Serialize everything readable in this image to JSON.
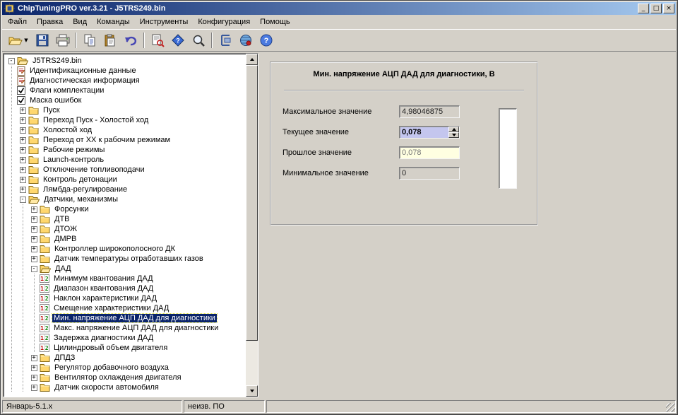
{
  "window": {
    "title": "ChipTuningPRO ver.3.21 - J5TRS249.bin",
    "controls": {
      "minimize": "_",
      "maximize": "□",
      "close": "×"
    }
  },
  "colors": {
    "titlebar_start": "#0a246a",
    "titlebar_end": "#a6caf0",
    "selection": "#0a246a",
    "chrome": "#d4d0c8",
    "editable_field": "#c4c6ee",
    "previous_field": "#ffffe1"
  },
  "menu": {
    "items": [
      {
        "id": "file",
        "label": "Файл"
      },
      {
        "id": "edit",
        "label": "Правка"
      },
      {
        "id": "view",
        "label": "Вид"
      },
      {
        "id": "commands",
        "label": "Команды"
      },
      {
        "id": "tools",
        "label": "Инструменты"
      },
      {
        "id": "configuration",
        "label": "Конфигурация"
      },
      {
        "id": "help",
        "label": "Помощь"
      }
    ]
  },
  "toolbar": {
    "buttons": [
      {
        "id": "open",
        "icon": "open",
        "dropdown": true
      },
      {
        "id": "save",
        "icon": "save"
      },
      {
        "id": "print",
        "icon": "print"
      },
      {
        "sep": true
      },
      {
        "id": "copy",
        "icon": "copy"
      },
      {
        "id": "paste",
        "icon": "paste"
      },
      {
        "id": "undo",
        "icon": "undo"
      },
      {
        "sep": true
      },
      {
        "id": "view-data",
        "icon": "doc-search"
      },
      {
        "id": "compare",
        "icon": "compare"
      },
      {
        "id": "search",
        "icon": "search"
      },
      {
        "sep": true
      },
      {
        "id": "calibration",
        "icon": "calibration"
      },
      {
        "id": "online",
        "icon": "globe"
      },
      {
        "id": "help",
        "icon": "help"
      }
    ]
  },
  "tree": {
    "root": {
      "label": "J5TRS249.bin",
      "icon": "folder-open",
      "expanded": true,
      "children": [
        {
          "label": "Идентификационные данные",
          "icon": "doc"
        },
        {
          "label": "Диагностическая информация",
          "icon": "doc"
        },
        {
          "label": "Флаги комплектации",
          "icon": "check"
        },
        {
          "label": "Маска ошибок",
          "icon": "check"
        },
        {
          "label": "Пуск",
          "icon": "folder",
          "expanded": false
        },
        {
          "label": "Переход Пуск - Холостой ход",
          "icon": "folder",
          "expanded": false
        },
        {
          "label": "Холостой ход",
          "icon": "folder",
          "expanded": false
        },
        {
          "label": "Переход от ХХ к рабочим режимам",
          "icon": "folder",
          "expanded": false
        },
        {
          "label": "Рабочие режимы",
          "icon": "folder",
          "expanded": false
        },
        {
          "label": "Launch-контроль",
          "icon": "folder",
          "expanded": false
        },
        {
          "label": "Отключение топливоподачи",
          "icon": "folder",
          "expanded": false
        },
        {
          "label": "Контроль детонации",
          "icon": "folder",
          "expanded": false
        },
        {
          "label": "Лямбда-регулирование",
          "icon": "folder",
          "expanded": false
        },
        {
          "label": "Датчики, механизмы",
          "icon": "folder-open",
          "expanded": true,
          "children": [
            {
              "label": "Форсунки",
              "icon": "folder",
              "expanded": false
            },
            {
              "label": "ДТВ",
              "icon": "folder",
              "expanded": false
            },
            {
              "label": "ДТОЖ",
              "icon": "folder",
              "expanded": false
            },
            {
              "label": "ДМРВ",
              "icon": "folder",
              "expanded": false
            },
            {
              "label": "Контроллер широкополосного ДК",
              "icon": "folder",
              "expanded": false
            },
            {
              "label": "Датчик температуры отработавших газов",
              "icon": "folder",
              "expanded": false
            },
            {
              "label": "ДАД",
              "icon": "folder-open",
              "expanded": true,
              "children": [
                {
                  "label": "Минимум квантования ДАД",
                  "icon": "param"
                },
                {
                  "label": "Диапазон квантования ДАД",
                  "icon": "param"
                },
                {
                  "label": "Наклон характеристики ДАД",
                  "icon": "param"
                },
                {
                  "label": "Смещение характеристики ДАД",
                  "icon": "param"
                },
                {
                  "label": "Мин. напряжение АЦП ДАД для диагностики",
                  "icon": "param",
                  "selected": true
                },
                {
                  "label": "Макс. напряжение АЦП ДАД для диагностики",
                  "icon": "param"
                },
                {
                  "label": "Задержка диагностики ДАД",
                  "icon": "param"
                },
                {
                  "label": "Цилиндровый объем двигателя",
                  "icon": "param"
                }
              ]
            },
            {
              "label": "ДПДЗ",
              "icon": "folder",
              "expanded": false
            },
            {
              "label": "Регулятор добавочного воздуха",
              "icon": "folder",
              "expanded": false
            },
            {
              "label": "Вентилятор охлаждения двигателя",
              "icon": "folder",
              "expanded": false
            },
            {
              "label": "Датчик скорости автомобиля",
              "icon": "folder",
              "expanded": false
            }
          ]
        }
      ]
    }
  },
  "panel": {
    "title": "Мин. напряжение АЦП ДАД для диагностики, В",
    "fields": [
      {
        "id": "max-value",
        "label": "Максимальное значение",
        "value": "4,98046875",
        "kind": "readonly"
      },
      {
        "id": "current-value",
        "label": "Текущее значение",
        "value": "0,078",
        "kind": "editable",
        "spinner": true
      },
      {
        "id": "previous-value",
        "label": "Прошлое значение",
        "value": "0,078",
        "kind": "previous"
      },
      {
        "id": "min-value",
        "label": "Минимальное значение",
        "value": "0",
        "kind": "readonly"
      }
    ]
  },
  "statusbar": {
    "left": "Январь-5.1.x",
    "middle": "неизв. ПО"
  }
}
